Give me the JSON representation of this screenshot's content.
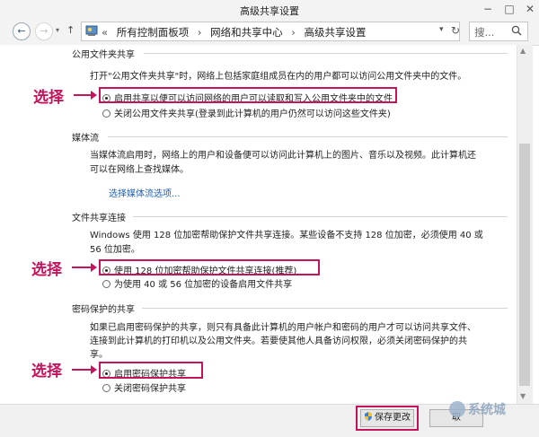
{
  "window": {
    "title": "高级共享设置",
    "minimize": "−",
    "maximize": "□",
    "close": "✕"
  },
  "nav": {
    "back": "←",
    "forward": "→",
    "up": "↑",
    "breadcrumb_prefix": "«",
    "breadcrumbs": [
      "所有控制面板项",
      "网络和共享中心",
      "高级共享设置"
    ],
    "separator": "›",
    "dropdown": "▾",
    "refresh": "↻",
    "search_placeholder": "搜..."
  },
  "sections": {
    "public_folder": {
      "heading": "公用文件夹共享",
      "description": "打开\"公用文件夹共享\"时，网络上包括家庭组成员在内的用户都可以访问公用文件夹中的文件。",
      "options": [
        "启用共享以便可以访问网络的用户可以读取和写入公用文件夹中的文件",
        "关闭公用文件夹共享(登录到此计算机的用户仍然可以访问这些文件夹)"
      ]
    },
    "media": {
      "heading": "媒体流",
      "description_line1": "当媒体流启用时，网络上的用户和设备便可以访问此计算机上的图片、音乐以及视频。此计算机还",
      "description_line2": "可以在网络上查找媒体。",
      "link": "选择媒体流选项..."
    },
    "file_sharing": {
      "heading": "文件共享连接",
      "description_line1": "Windows 使用 128 位加密帮助保护文件共享连接。某些设备不支持 128 位加密，必须使用 40 或",
      "description_line2": "56 位加密。",
      "options": [
        "使用 128 位加密帮助保护文件共享连接(推荐)",
        "为使用 40 或 56 位加密的设备启用文件共享"
      ]
    },
    "password": {
      "heading": "密码保护的共享",
      "description_line1": "如果已启用密码保护的共享，则只有具备此计算机的用户帐户和密码的用户才可以访问共享文件、",
      "description_line2": "连接到此计算机的打印机以及公用文件夹。若要使其他人具备访问权限，必须关闭密码保护的共",
      "description_line3": "享。",
      "options": [
        "启用密码保护共享",
        "关闭密码保护共享"
      ]
    }
  },
  "annotations": {
    "label": "选择"
  },
  "footer": {
    "save_label": "保存更改",
    "cancel_label": "取"
  },
  "watermark": "系统城",
  "colors": {
    "annotation": "#c4145c",
    "link": "#1c5fb0"
  }
}
